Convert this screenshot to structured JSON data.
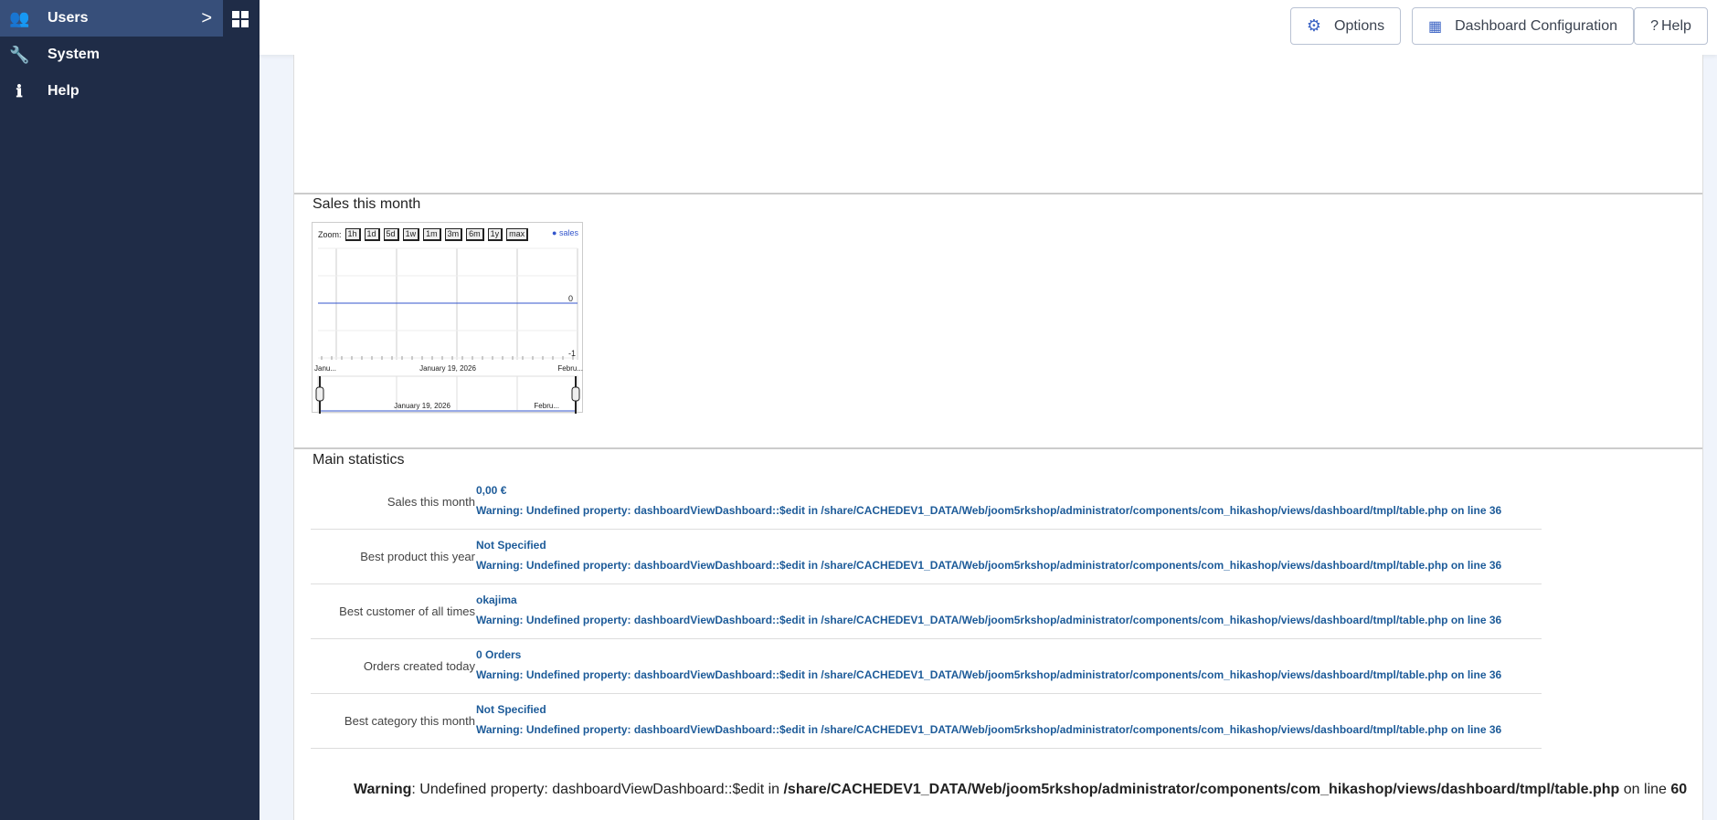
{
  "sidebar": {
    "items": [
      {
        "label": "Users",
        "icon": "users-icon"
      },
      {
        "label": "System",
        "icon": "wrench-icon"
      },
      {
        "label": "Help",
        "icon": "info-icon"
      }
    ]
  },
  "toolbar": {
    "options": "Options",
    "dashboard_config": "Dashboard Configuration",
    "help": "Help"
  },
  "chart_section": {
    "title": "Sales this month"
  },
  "chart_data": {
    "type": "line",
    "title": "",
    "zoom_label": "Zoom:",
    "zoom_buttons": [
      "1h",
      "1d",
      "5d",
      "1w",
      "1m",
      "3m",
      "6m",
      "1y",
      "max"
    ],
    "legend": [
      "sales"
    ],
    "series": [
      {
        "name": "sales",
        "values": [
          0,
          0
        ]
      }
    ],
    "y_ticks": [
      "0",
      "-1"
    ],
    "x_ticks": [
      "Janu...",
      "January 19, 2026",
      "Febru..."
    ],
    "nav_ticks": [
      "January 19, 2026",
      "Febru..."
    ],
    "color": "#3355cc"
  },
  "stats": {
    "title": "Main statistics",
    "warning": "Warning: Undefined property: dashboardViewDashboard::$edit in /share/CACHEDEV1_DATA/Web/joom5rkshop/administrator/components/com_hikashop/views/dashboard/tmpl/table.php on line 36",
    "rows": [
      {
        "label": "Sales this month",
        "value": "0,00 €"
      },
      {
        "label": "Best product this year",
        "value": "Not Specified"
      },
      {
        "label": "Best customer of all times",
        "value": "okajima"
      },
      {
        "label": "Orders created today",
        "value": "0 Orders"
      },
      {
        "label": "Best category this month",
        "value": "Not Specified"
      }
    ]
  },
  "bottom_warning": {
    "prefix": "Warning",
    "message": ": Undefined property: dashboardViewDashboard::$edit in ",
    "path": "/share/CACHEDEV1_DATA/Web/joom5rkshop/administrator/components/com_hikashop/views/dashboard/tmpl/table.php",
    "line_text": " on line ",
    "line": "60"
  }
}
